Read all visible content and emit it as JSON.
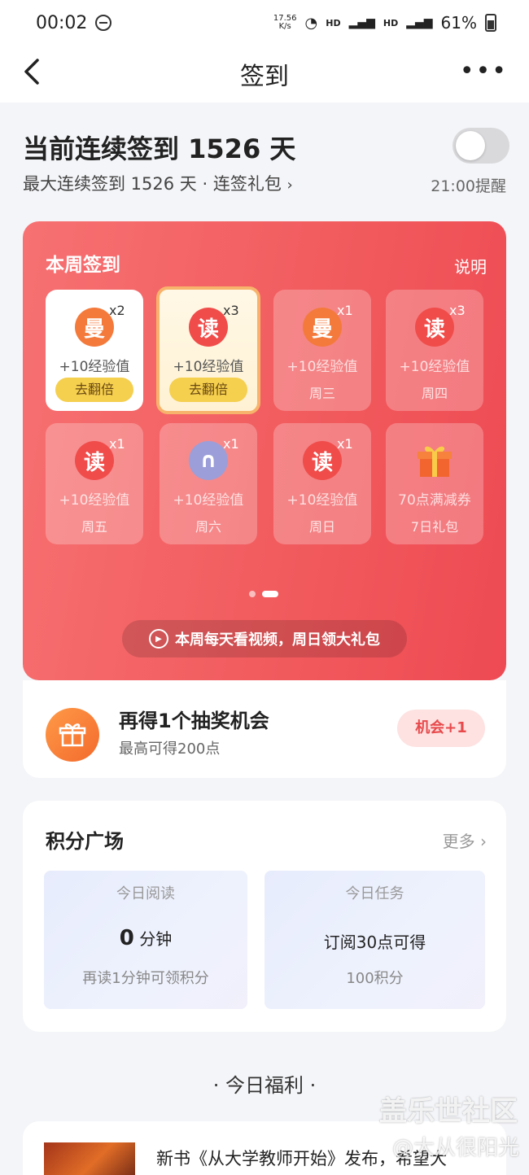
{
  "status_bar": {
    "time": "00:02",
    "net_speed": "17.56",
    "net_unit": "K/s",
    "hd1": "HD",
    "hd2": "HD",
    "battery": "61%"
  },
  "nav": {
    "title": "签到",
    "more": "•••"
  },
  "streak": {
    "title": "当前连续签到 1526 天",
    "sub": "最大连续签到 1526 天 · 连签礼包",
    "remind": "21:00提醒",
    "toggle_on": false
  },
  "week": {
    "title": "本周签到",
    "explain": "说明",
    "days": [
      {
        "icon": "manhua-icon",
        "glyph": "曼",
        "mult": "x2",
        "exp": "+10经验值",
        "button": "去翻倍",
        "state": "done"
      },
      {
        "icon": "du-icon",
        "glyph": "读",
        "mult": "x3",
        "exp": "+10经验值",
        "button": "去翻倍",
        "state": "today"
      },
      {
        "icon": "manhua-icon",
        "glyph": "曼",
        "mult": "x1",
        "exp": "+10经验值",
        "label": "周三",
        "state": "future"
      },
      {
        "icon": "du-icon",
        "glyph": "读",
        "mult": "x3",
        "exp": "+10经验值",
        "label": "周四",
        "state": "future"
      },
      {
        "icon": "du-icon",
        "glyph": "读",
        "mult": "x1",
        "exp": "+10经验值",
        "label": "周五",
        "state": "future"
      },
      {
        "icon": "headphone-icon",
        "glyph": "∩",
        "mult": "x1",
        "exp": "+10经验值",
        "label": "周六",
        "state": "future"
      },
      {
        "icon": "du-icon",
        "glyph": "读",
        "mult": "x1",
        "exp": "+10经验值",
        "label": "周日",
        "state": "future"
      },
      {
        "icon": "gift-icon",
        "glyph": "",
        "mult": "",
        "exp": "70点满减券",
        "label": "7日礼包",
        "state": "future"
      }
    ],
    "video_banner": "本周每天看视频，周日领大礼包"
  },
  "lottery": {
    "title": "再得1个抽奖机会",
    "sub": "最高可得200点",
    "button": "机会+1"
  },
  "plaza": {
    "title": "积分广场",
    "more": "更多",
    "tiles": [
      {
        "header": "今日阅读",
        "value": "0",
        "unit": "分钟",
        "sub": "再读1分钟可领积分"
      },
      {
        "header": "今日任务",
        "value": "",
        "unit": "订阅30点可得",
        "sub": "100积分"
      }
    ]
  },
  "benefit": {
    "title": "· 今日福利 ·"
  },
  "news": {
    "text": "新书《从大学教师开始》发布，希望大"
  },
  "watermark": {
    "line1": "盖乐世社区",
    "line2": "@大从很阳光"
  }
}
